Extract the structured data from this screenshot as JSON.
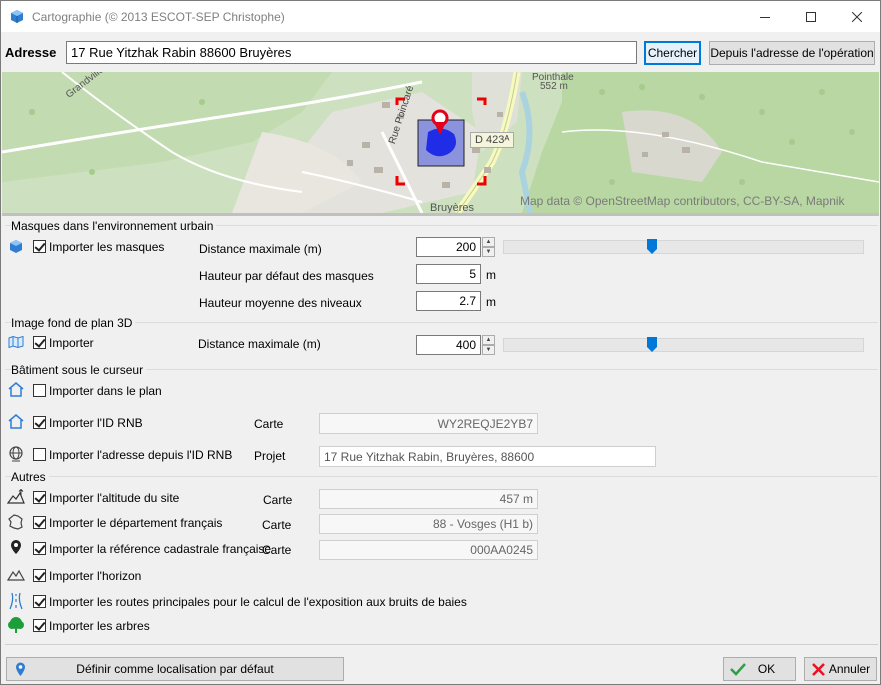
{
  "window": {
    "title": "Cartographie (© 2013 ESCOT-SEP Christophe)"
  },
  "address": {
    "label": "Adresse",
    "value": "17 Rue Yitzhak Rabin 88600 Bruyères",
    "search_button": "Chercher",
    "from_operation_button": "Depuis l'adresse de l'opération"
  },
  "map": {
    "attribution": "Map data © OpenStreetMap contributors, CC-BY-SA, Mapnik",
    "road_badge": "D 423ᴬ",
    "place_label": "Pointhale",
    "altitude_label": "552 m",
    "street_label_1": "Rue Poincaré",
    "street_label_2": "Grandvillers",
    "town_label": "Bruyères"
  },
  "masks": {
    "title": "Masques dans l'environnement urbain",
    "import_label": "Importer les masques",
    "import_checked": true,
    "max_distance_label": "Distance maximale (m)",
    "max_distance_value": "200",
    "default_height_label": "Hauteur par défaut des masques",
    "default_height_value": "5",
    "default_height_unit": "m",
    "avg_level_label": "Hauteur moyenne des niveaux",
    "avg_level_value": "2.7",
    "avg_level_unit": "m",
    "slider_fraction": 0.4
  },
  "background": {
    "title": "Image fond de plan 3D",
    "import_label": "Importer",
    "import_checked": true,
    "max_distance_label": "Distance maximale (m)",
    "max_distance_value": "400",
    "slider_fraction": 0.4
  },
  "building": {
    "title": "Bâtiment sous le curseur",
    "import_plan_label": "Importer dans le plan",
    "import_rnb_label": "Importer l'ID RNB",
    "rnb_source_label": "Carte",
    "rnb_value": "WY2REQJE2YB7",
    "import_address_label": "Importer l'adresse depuis l'ID RNB",
    "address_source_label": "Projet",
    "address_value": "17 Rue Yitzhak Rabin, Bruyères, 88600"
  },
  "others": {
    "title": "Autres",
    "altitude_label": "Importer l'altitude du site",
    "altitude_source": "Carte",
    "altitude_value": "457 m",
    "department_label": "Importer le département français",
    "department_source": "Carte",
    "department_value": "88 - Vosges (H1 b)",
    "cadastral_label": "Importer la référence cadastrale française",
    "cadastral_source": "Carte",
    "cadastral_value": "000AA0245",
    "horizon_label": "Importer l'horizon",
    "roads_label": "Importer les routes principales pour le calcul de l'exposition aux bruits de baies",
    "trees_label": "Importer les arbres"
  },
  "footer": {
    "default_location_button": "Définir comme localisation par défaut",
    "ok_button": "OK",
    "cancel_button": "Annuler"
  },
  "colors": {
    "accent": "#0078d7",
    "icon_blue": "#2f7dd1",
    "cancel_red": "#e81123",
    "ok_green": "#2ea043"
  }
}
